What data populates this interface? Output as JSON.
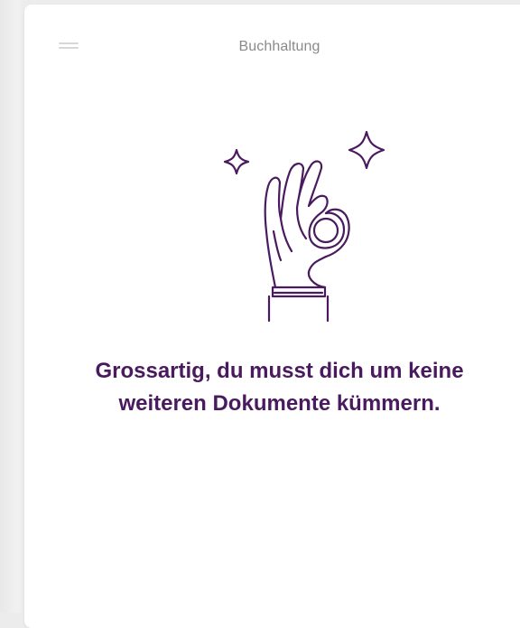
{
  "header": {
    "title": "Buchhaltung",
    "menu_icon": "hamburger-menu-icon"
  },
  "empty_state": {
    "illustration_icon": "ok-hand-sparkles-icon",
    "message": "Grossartig, du musst dich um keine weiteren Dokumente kümmern."
  },
  "colors": {
    "accent": "#4a1a5e",
    "title_text": "#8a8a8a",
    "menu_icon": "#d7d7d7"
  }
}
